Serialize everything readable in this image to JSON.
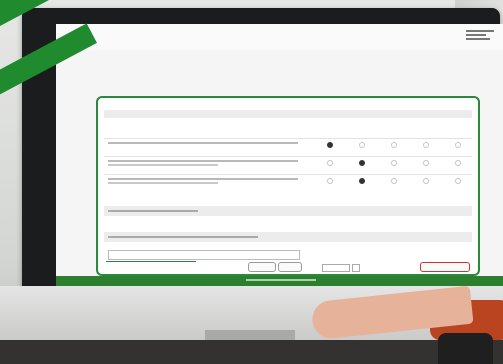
{
  "photo": {
    "subject": "computer-monitor-with-survey-form",
    "accent_color": "#1f8a2e",
    "card_border_color": "#2a8a3a",
    "footer_color": "#2c7f2f"
  },
  "form": {
    "rows": [
      {
        "selected": 1
      },
      {
        "selected": 2
      },
      {
        "selected": 2
      }
    ]
  }
}
